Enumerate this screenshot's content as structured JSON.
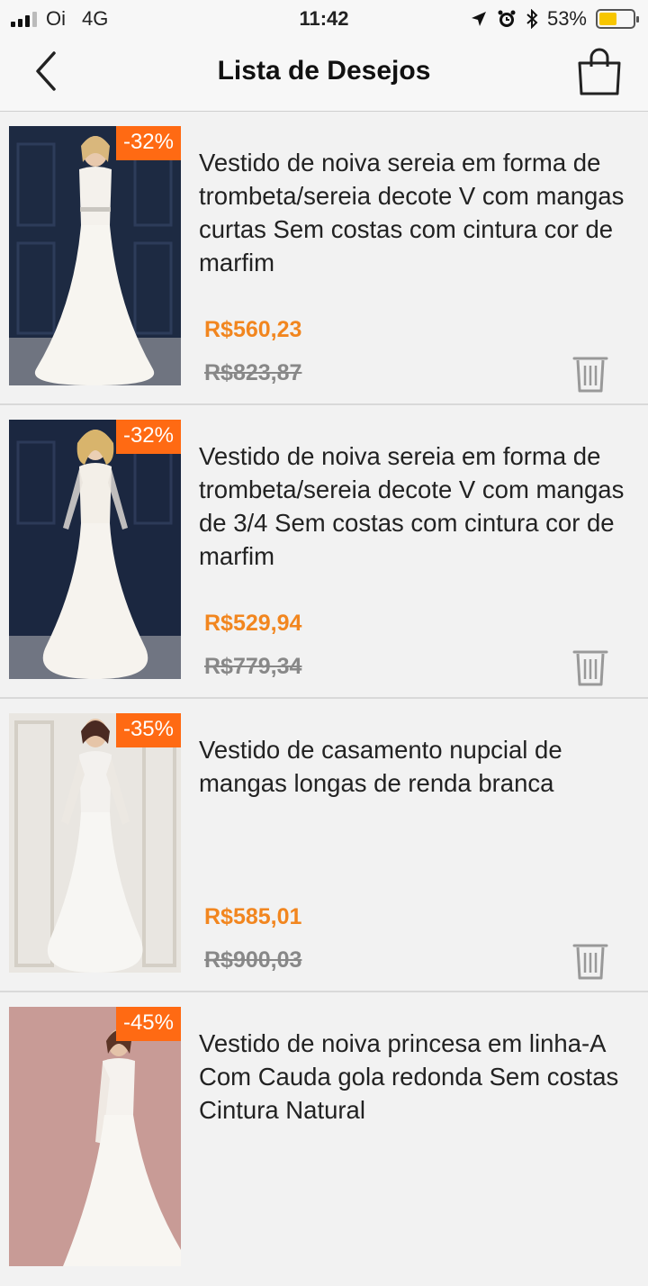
{
  "status_bar": {
    "carrier": "Oi",
    "network": "4G",
    "time": "11:42",
    "battery": "53%",
    "battery_level": 0.53
  },
  "header": {
    "title": "Lista de Desejos"
  },
  "items": [
    {
      "discount": "-32%",
      "title": "Vestido de noiva sereia em forma de trombeta/sereia decote V com mangas curtas Sem costas com cintura cor de marfim",
      "price": "R$560,23",
      "old_price": "R$823,87"
    },
    {
      "discount": "-32%",
      "title": "Vestido de noiva sereia em forma de trombeta/sereia decote V com mangas de 3/4 Sem costas com cintura cor de marfim",
      "price": "R$529,94",
      "old_price": "R$779,34"
    },
    {
      "discount": "-35%",
      "title": "Vestido de casamento nupcial de mangas longas de renda branca",
      "price": "R$585,01",
      "old_price": "R$900,03"
    },
    {
      "discount": "-45%",
      "title": "Vestido de noiva princesa em linha-A Com Cauda gola redonda Sem costas Cintura Natural",
      "price": "",
      "old_price": ""
    }
  ],
  "colors": {
    "accent": "#f2861f",
    "badge": "#ff6a13"
  }
}
